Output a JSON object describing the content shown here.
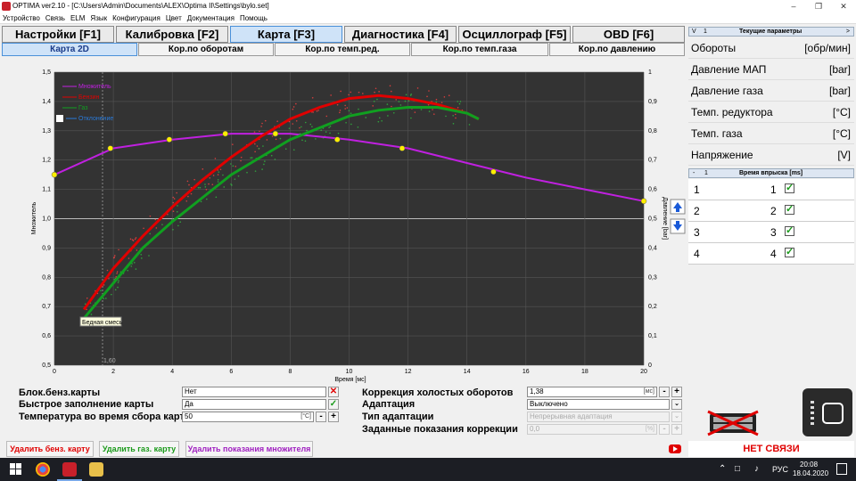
{
  "titlebar": {
    "title": "OPTIMA ver2.10 - [C:\\Users\\Admin\\Documents\\ALEX\\Optima II\\Settings\\bylo.set]"
  },
  "menu": [
    "Устройство",
    "Связь",
    "ELM",
    "Язык",
    "Конфигурация",
    "Цвет",
    "Документация",
    "Помощь"
  ],
  "tabs": [
    "Настройки [F1]",
    "Калибровка [F2]",
    "Карта [F3]",
    "Диагностика [F4]",
    "Осциллограф [F5]",
    "OBD [F6]"
  ],
  "subtabs": [
    "Карта 2D",
    "Кор.по оборотам",
    "Кор.по темп.ред.",
    "Кор.по темп.газа",
    "Кор.по давлению"
  ],
  "chart_data": {
    "type": "line",
    "xlabel": "Время [мс]",
    "ylabel": "Множитель",
    "y2label": "Давление [bar]",
    "xlim": [
      0,
      20
    ],
    "ylim": [
      0.5,
      1.5
    ],
    "y2lim": [
      0,
      1
    ],
    "xticks": [
      0,
      2,
      4,
      6,
      8,
      10,
      12,
      14,
      16,
      18,
      20
    ],
    "yticks": [
      "0,5",
      "0,6",
      "0,7",
      "0,8",
      "0,9",
      "1,0",
      "1,1",
      "1,2",
      "1,3",
      "1,4",
      "1,5"
    ],
    "y2ticks": [
      "0",
      "0,1",
      "0,2",
      "0,3",
      "0,4",
      "0,5",
      "0,6",
      "0,7",
      "0,8",
      "0,9",
      "1"
    ],
    "legend": [
      "Множитель",
      "Бензин",
      "Газ",
      "Отклонение"
    ],
    "cursor_label": "1,60",
    "annotation": "Бедная смесь",
    "colors": {
      "multiplier": "#c020e0",
      "petrol": "#e00000",
      "gas": "#10a020",
      "bg": "#333333"
    },
    "series": [
      {
        "name": "Множитель",
        "x": [
          0,
          2,
          4,
          6,
          8,
          10,
          12,
          14,
          16,
          18,
          20
        ],
        "y": [
          1.15,
          1.24,
          1.27,
          1.29,
          1.29,
          1.27,
          1.24,
          1.19,
          1.14,
          1.1,
          1.06
        ],
        "points": [
          [
            0,
            1.15
          ],
          [
            1.9,
            1.24
          ],
          [
            3.9,
            1.27
          ],
          [
            5.8,
            1.29
          ],
          [
            7.5,
            1.29
          ],
          [
            9.6,
            1.27
          ],
          [
            11.8,
            1.24
          ],
          [
            14.9,
            1.16
          ],
          [
            20,
            1.06
          ]
        ]
      },
      {
        "name": "Бензин",
        "x": [
          1,
          2,
          3,
          4,
          5,
          6,
          7,
          8,
          9,
          10,
          11,
          12,
          13,
          14,
          14.4
        ],
        "y": [
          0.69,
          0.83,
          0.94,
          1.04,
          1.13,
          1.21,
          1.28,
          1.34,
          1.38,
          1.41,
          1.42,
          1.41,
          1.39,
          1.36,
          1.34
        ]
      },
      {
        "name": "Газ",
        "x": [
          1,
          2,
          3,
          4,
          5,
          6,
          7,
          8,
          9,
          10,
          11,
          12,
          13,
          14,
          14.4
        ],
        "y": [
          0.66,
          0.78,
          0.9,
          0.99,
          1.07,
          1.15,
          1.21,
          1.27,
          1.31,
          1.35,
          1.37,
          1.38,
          1.38,
          1.36,
          1.34
        ]
      }
    ]
  },
  "form": {
    "petrol_block_label": "Блок.бенз.карты",
    "petrol_block_value": "Нет",
    "fast_fill_label": "Быстрое заполнение карты",
    "fast_fill_value": "Да",
    "temp_label": "Температура во время сбора карт",
    "temp_value": "50",
    "temp_unit": "[°C]",
    "idle_corr_label": "Коррекция холостых оборотов",
    "idle_corr_value": "1,38",
    "idle_corr_unit": "[мс]",
    "adapt_label": "Адаптация",
    "adapt_value": "Выключено",
    "adapt_type_label": "Тип адаптации",
    "adapt_type_value": "Непрерывная адаптация",
    "corr_label": "Заданные показания коррекции",
    "corr_value": "0,0",
    "corr_unit": "[%]"
  },
  "buttons": {
    "del_petrol": "Удалить бенз. карту",
    "del_gas": "Удалить газ. карту",
    "del_mult": "Удалить показания множителя"
  },
  "right": {
    "header": "Текущие параметры",
    "params": [
      {
        "name": "Обороты",
        "unit": "[обр/мин]"
      },
      {
        "name": "Давление МАП",
        "unit": "[bar]"
      },
      {
        "name": "Давление газа",
        "unit": "[bar]"
      },
      {
        "name": "Темп. редуктора",
        "unit": "[°C]"
      },
      {
        "name": "Темп. газа",
        "unit": "[°C]"
      },
      {
        "name": "Напряжение",
        "unit": "[V]"
      }
    ],
    "inj_header": "Время впрыска [ms]",
    "inj_num": "1",
    "injectors": [
      "1",
      "2",
      "3",
      "4"
    ],
    "no_connection": "НЕТ СВЯЗИ"
  },
  "taskbar": {
    "time": "20:08",
    "date": "18.04.2020",
    "lang": "РУС"
  }
}
